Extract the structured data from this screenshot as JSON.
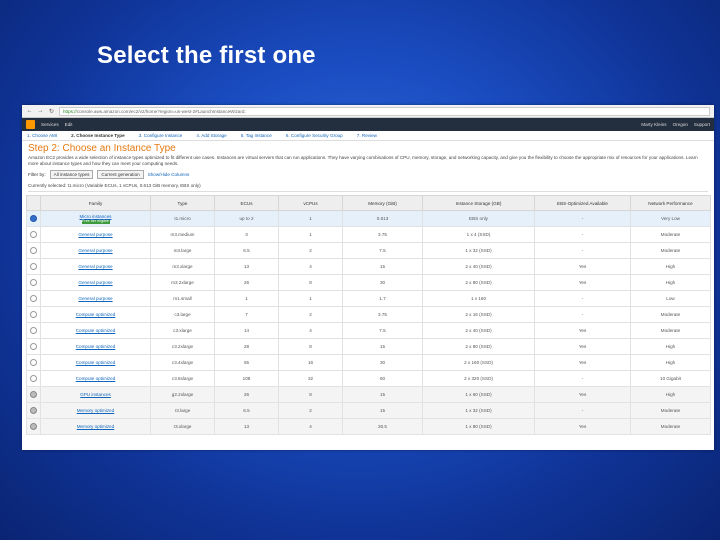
{
  "slide": {
    "title": "Select the first one"
  },
  "browser": {
    "url_secure": "https://",
    "url": "console.aws.amazon.com/ec2/v2/home?region=us-west-2#LaunchInstanceWizard:"
  },
  "aws_nav": {
    "services": "Services",
    "edit": "Edit",
    "account": "Marty Kleins",
    "region": "Oregon",
    "support": "Support"
  },
  "wizard": {
    "tabs": [
      "1. Choose AMI",
      "2. Choose Instance Type",
      "3. Configure Instance",
      "4. Add Storage",
      "5. Tag Instance",
      "6. Configure Security Group",
      "7. Review"
    ],
    "step_title": "Step 2: Choose an Instance Type",
    "description": "Amazon EC2 provides a wide selection of instance types optimized to fit different use cases. Instances are virtual servers that can run applications. They have varying combinations of CPU, memory, storage, and networking capacity, and give you the flexibility to choose the appropriate mix of resources for your applications. Learn more about instance types and how they can meet your computing needs.",
    "filter_label": "Filter by:",
    "filter_value": "All instance types",
    "generation_value": "Current generation",
    "show_hide": "Show/Hide Columns",
    "currently_selected": "Currently selected: t1.micro (Variable ECUs, 1 vCPUs, 0.613 GiB memory, EBS only)"
  },
  "table": {
    "headers": [
      "",
      "Family",
      "Type",
      "ECUs",
      "vCPUs",
      "Memory (GiB)",
      "Instance Storage (GB)",
      "EBS-Optimized Available",
      "Network Performance"
    ],
    "rows": [
      {
        "family": "Micro instances",
        "badge": "Free tier eligible",
        "type": "t1.micro",
        "ecus": "up to 2",
        "vcpus": "1",
        "memory": "0.613",
        "storage": "EBS only",
        "ebs": "-",
        "network": "Very Low"
      },
      {
        "family": "General purpose",
        "type": "m3.medium",
        "ecus": "3",
        "vcpus": "1",
        "memory": "3.75",
        "storage": "1 x 4 (SSD)",
        "ebs": "-",
        "network": "Moderate"
      },
      {
        "family": "General purpose",
        "type": "m3.large",
        "ecus": "6.5",
        "vcpus": "2",
        "memory": "7.5",
        "storage": "1 x 32 (SSD)",
        "ebs": "-",
        "network": "Moderate"
      },
      {
        "family": "General purpose",
        "type": "m3.xlarge",
        "ecus": "13",
        "vcpus": "4",
        "memory": "15",
        "storage": "2 x 40 (SSD)",
        "ebs": "Yes",
        "network": "High"
      },
      {
        "family": "General purpose",
        "type": "m3.2xlarge",
        "ecus": "26",
        "vcpus": "8",
        "memory": "30",
        "storage": "2 x 80 (SSD)",
        "ebs": "Yes",
        "network": "High"
      },
      {
        "family": "General purpose",
        "type": "m1.small",
        "ecus": "1",
        "vcpus": "1",
        "memory": "1.7",
        "storage": "1 x 160",
        "ebs": "-",
        "network": "Low"
      },
      {
        "family": "Compute optimized",
        "type": "c3.large",
        "ecus": "7",
        "vcpus": "2",
        "memory": "3.75",
        "storage": "2 x 16 (SSD)",
        "ebs": "-",
        "network": "Moderate"
      },
      {
        "family": "Compute optimized",
        "type": "c3.xlarge",
        "ecus": "14",
        "vcpus": "4",
        "memory": "7.5",
        "storage": "2 x 40 (SSD)",
        "ebs": "Yes",
        "network": "Moderate"
      },
      {
        "family": "Compute optimized",
        "type": "c3.2xlarge",
        "ecus": "28",
        "vcpus": "8",
        "memory": "15",
        "storage": "2 x 80 (SSD)",
        "ebs": "Yes",
        "network": "High"
      },
      {
        "family": "Compute optimized",
        "type": "c3.4xlarge",
        "ecus": "55",
        "vcpus": "16",
        "memory": "30",
        "storage": "2 x 160 (SSD)",
        "ebs": "Yes",
        "network": "High"
      },
      {
        "family": "Compute optimized",
        "type": "c3.8xlarge",
        "ecus": "108",
        "vcpus": "32",
        "memory": "60",
        "storage": "2 x 320 (SSD)",
        "ebs": "-",
        "network": "10 Gigabit"
      },
      {
        "family": "GPU instances",
        "type": "g2.2xlarge",
        "ecus": "26",
        "vcpus": "8",
        "memory": "15",
        "storage": "1 x 60 (SSD)",
        "ebs": "Yes",
        "network": "High",
        "prev": true
      },
      {
        "family": "Memory optimized",
        "type": "r3.large",
        "ecus": "6.5",
        "vcpus": "2",
        "memory": "15",
        "storage": "1 x 32 (SSD)",
        "ebs": "-",
        "network": "Moderate",
        "prev": true
      },
      {
        "family": "Memory optimized",
        "type": "r3.xlarge",
        "ecus": "13",
        "vcpus": "4",
        "memory": "30.5",
        "storage": "1 x 80 (SSD)",
        "ebs": "Yes",
        "network": "Moderate",
        "prev": true
      }
    ]
  }
}
